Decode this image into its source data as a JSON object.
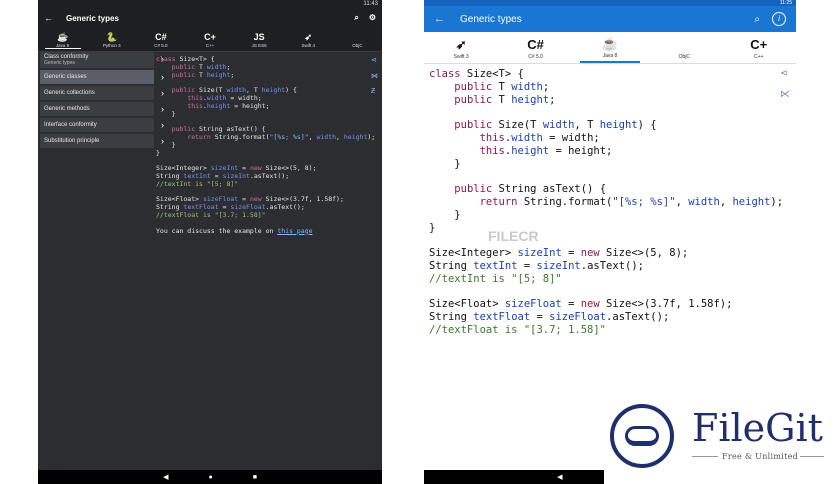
{
  "dark": {
    "status_time": "11:43",
    "title": "Generic types",
    "languages": [
      {
        "glyph": "☕",
        "label": "Java 8"
      },
      {
        "glyph": "🐍",
        "label": "Python 3"
      },
      {
        "glyph": "C#",
        "label": "C# 5.0"
      },
      {
        "glyph": "C+",
        "label": "C++"
      },
      {
        "glyph": "JS",
        "label": "JS ES6"
      },
      {
        "glyph": "➶",
        "label": "Swift 4"
      },
      {
        "glyph": "",
        "label": "ObjC"
      }
    ],
    "menu": [
      {
        "label": "Class conformity",
        "sub": "Generic types"
      },
      {
        "label": "Generic classes"
      },
      {
        "label": "Generic collections"
      },
      {
        "label": "Generic methods"
      },
      {
        "label": "Interface conformity"
      },
      {
        "label": "Substitution principle"
      }
    ],
    "discuss_text": "You can discuss the example on",
    "discuss_link": "this page"
  },
  "light": {
    "status_time": "11:25",
    "title": "Generic types",
    "languages": [
      {
        "glyph": "➶",
        "label": "Swift 3"
      },
      {
        "glyph": "C#",
        "label": "C# 5.0"
      },
      {
        "glyph": "☕",
        "label": "Java 8"
      },
      {
        "glyph": "",
        "label": "ObjC"
      },
      {
        "glyph": "C+",
        "label": "C++"
      }
    ],
    "watermark": "FILECR"
  },
  "logo": {
    "name": "FileGit",
    "tagline": "Free & Unlimited"
  },
  "colors": {
    "light_appbar": "#1976d2",
    "dark_bg": "#2b2d31",
    "logo_navy": "#1e2f6b"
  }
}
